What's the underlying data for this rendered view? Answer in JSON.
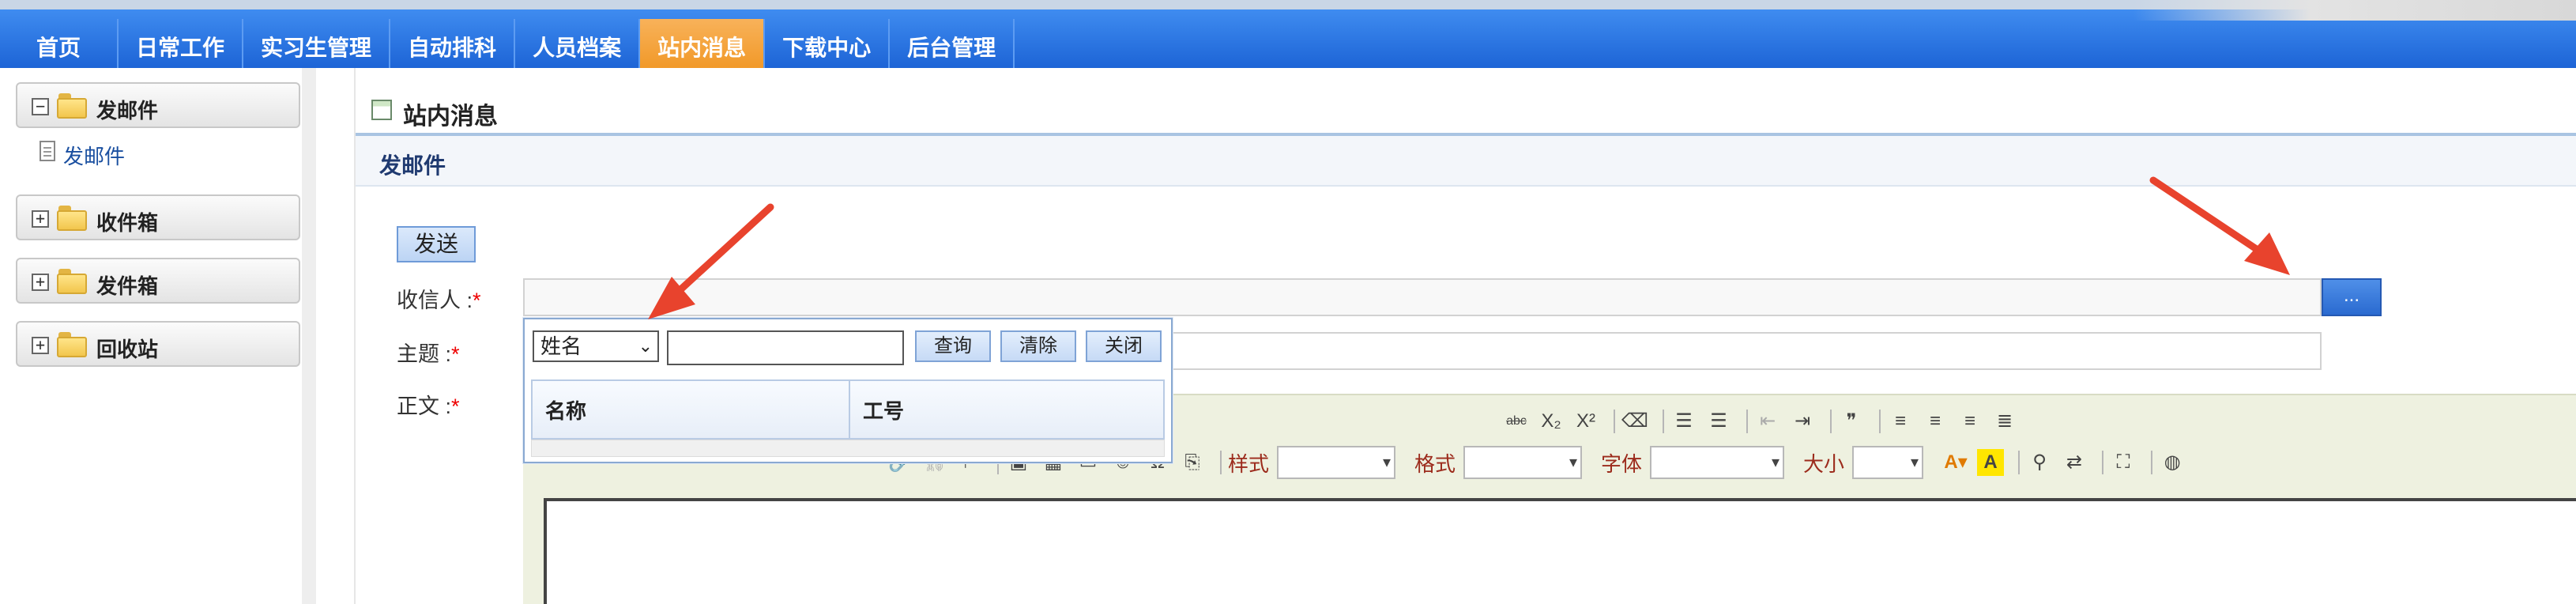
{
  "nav": {
    "items": [
      "首页",
      "日常工作",
      "实习生管理",
      "自动排科",
      "人员档案",
      "站内消息",
      "下载中心",
      "后台管理"
    ],
    "active_index": 5
  },
  "sidebar": {
    "groups": [
      {
        "label": "发邮件",
        "expanded": true,
        "toggle": "−"
      },
      {
        "label": "收件箱",
        "expanded": false,
        "toggle": "+"
      },
      {
        "label": "发件箱",
        "expanded": false,
        "toggle": "+"
      },
      {
        "label": "回收站",
        "expanded": false,
        "toggle": "+"
      }
    ],
    "sub_item": "发邮件"
  },
  "main": {
    "title": "站内消息",
    "subtitle": "发邮件",
    "send_label": "发送",
    "recipient_label": "收信人 :",
    "subject_label": "主题 :",
    "body_label": "正文 :",
    "required_mark": "*",
    "picker_button": "..."
  },
  "editor": {
    "style_label": "样式",
    "format_label": "格式",
    "font_label": "字体",
    "size_label": "大小",
    "row1_icons": [
      "strike-icon",
      "subscript-icon",
      "superscript-icon",
      "eraser-icon",
      "ordered-list-icon",
      "bullet-list-icon",
      "outdent-icon",
      "indent-icon",
      "blockquote-icon",
      "align-left-icon",
      "align-center-icon",
      "align-right-icon",
      "justify-icon"
    ],
    "row2_icons": [
      "link-icon",
      "unlink-icon",
      "anchor-icon",
      "image-icon",
      "table-icon",
      "rule-icon",
      "smiley-icon",
      "special-char-icon",
      "pagebreak-icon"
    ]
  },
  "popup": {
    "field_select": "姓名",
    "search_label": "查询",
    "clear_label": "清除",
    "close_label": "关闭",
    "columns": [
      "名称",
      "工号"
    ]
  },
  "colors": {
    "nav_blue": "#2a74e0",
    "nav_active": "#f39b2a",
    "arrow_red": "#e8432d"
  }
}
